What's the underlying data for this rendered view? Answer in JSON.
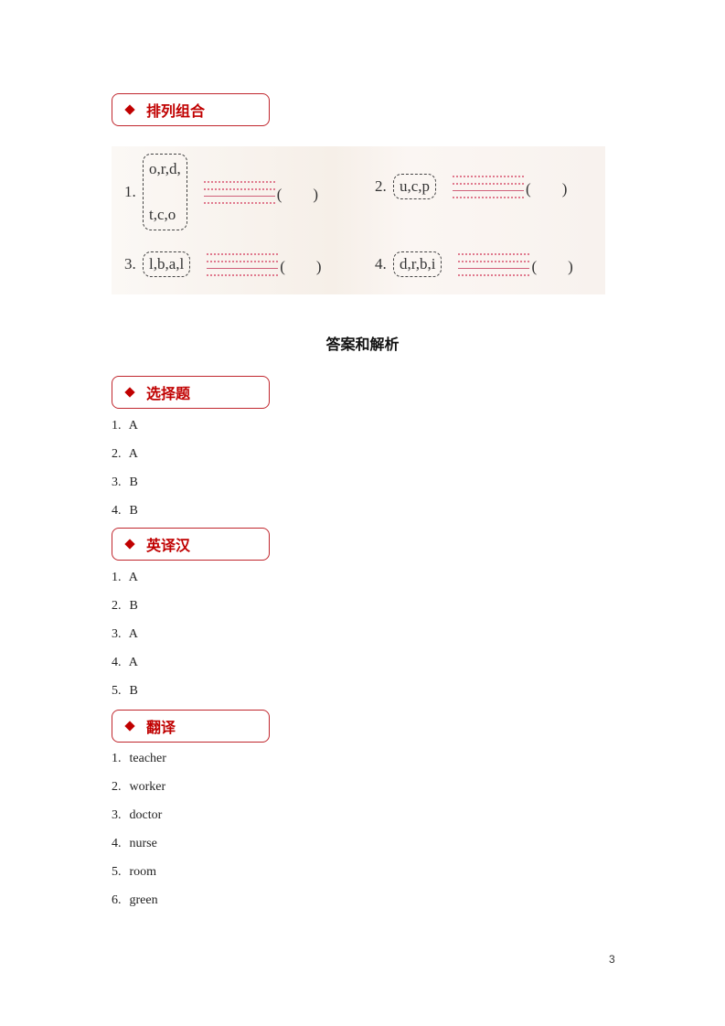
{
  "section_arrange": {
    "title": "排列组合"
  },
  "exercise": {
    "items": [
      {
        "num": "1.",
        "letters_line1": "o,r,d,",
        "letters_line2": "t,c,o",
        "paren": "(　　)"
      },
      {
        "num": "2.",
        "letters": "u,c,p",
        "paren": "(　　)"
      },
      {
        "num": "3.",
        "letters": "l,b,a,l",
        "paren": "(　　)"
      },
      {
        "num": "4.",
        "letters": "d,r,b,i",
        "paren": "(　　)"
      }
    ]
  },
  "answer_title": "答案和解析",
  "section_choice": {
    "title": "选择题",
    "answers": [
      {
        "num": "1.",
        "value": "A"
      },
      {
        "num": "2.",
        "value": "A"
      },
      {
        "num": "3.",
        "value": "B"
      },
      {
        "num": "4.",
        "value": "B"
      }
    ]
  },
  "section_en_cn": {
    "title": "英译汉",
    "answers": [
      {
        "num": "1.",
        "value": "A"
      },
      {
        "num": "2.",
        "value": "B"
      },
      {
        "num": "3.",
        "value": "A"
      },
      {
        "num": "4.",
        "value": "A"
      },
      {
        "num": "5.",
        "value": "B"
      }
    ]
  },
  "section_translate": {
    "title": "翻译",
    "answers": [
      {
        "num": "1.",
        "value": "teacher"
      },
      {
        "num": "2.",
        "value": "worker"
      },
      {
        "num": "3.",
        "value": "doctor"
      },
      {
        "num": "4.",
        "value": "nurse"
      },
      {
        "num": "5.",
        "value": "room"
      },
      {
        "num": "6.",
        "value": "green"
      }
    ]
  },
  "page_number": "3"
}
